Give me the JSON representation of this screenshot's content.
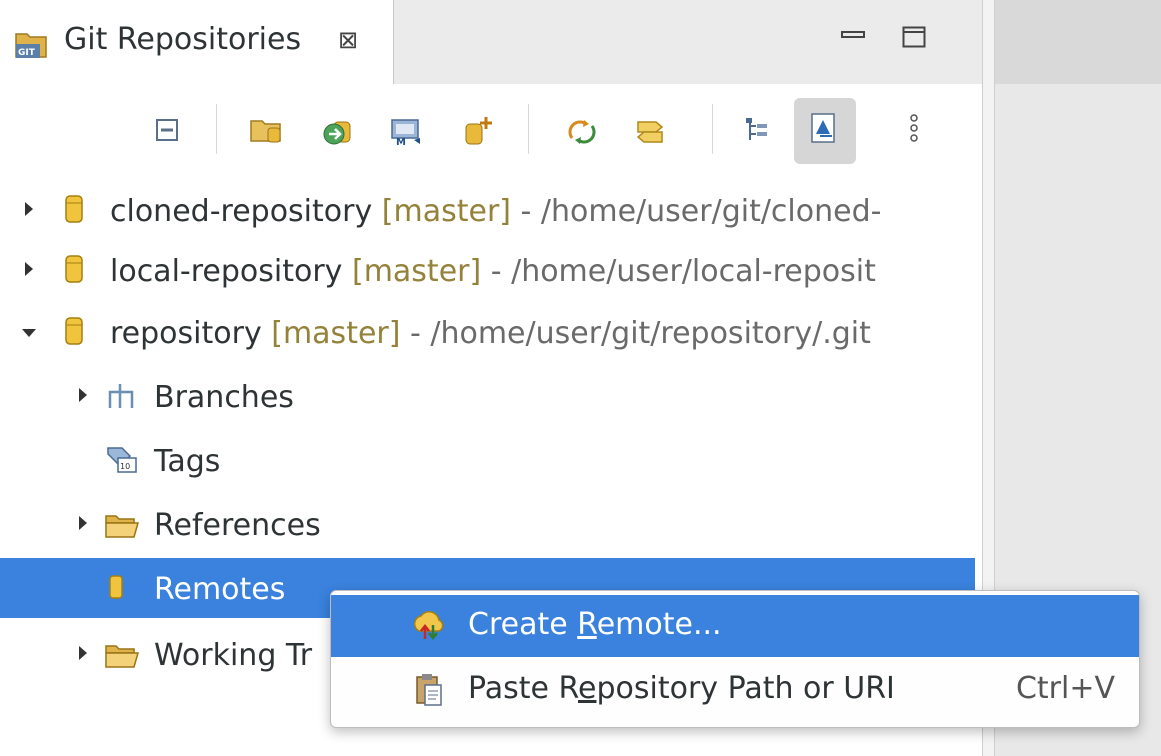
{
  "view": {
    "title": "Git Repositories",
    "close_glyph": "⊠",
    "icon": "git-repositories-view-icon"
  },
  "toolbar": {
    "buttons": [
      {
        "name": "collapse-all-button",
        "icon": "collapse-all-icon"
      },
      {
        "name": "add-existing-repository-button",
        "icon": "add-repository-icon"
      },
      {
        "name": "clone-repository-button",
        "icon": "clone-repository-icon"
      },
      {
        "name": "import-projects-button",
        "icon": "import-projects-icon"
      },
      {
        "name": "create-repository-button",
        "icon": "create-repository-icon"
      },
      {
        "name": "refresh-button",
        "icon": "refresh-icon"
      },
      {
        "name": "link-with-selection-button",
        "icon": "link-with-selection-icon"
      },
      {
        "name": "hierarchical-branch-layout-button",
        "icon": "hierarchy-icon"
      },
      {
        "name": "compact-view-button",
        "icon": "compact-view-icon",
        "pressed": true
      },
      {
        "name": "view-menu-button",
        "icon": "vertical-dots-icon"
      }
    ]
  },
  "tree": {
    "repositories": [
      {
        "name": "cloned-repository",
        "branch": "[master]",
        "path": " - /home/user/git/cloned-",
        "expanded": false
      },
      {
        "name": "local-repository",
        "branch": "[master]",
        "path": " - /home/user/local-reposit",
        "expanded": false
      },
      {
        "name": "repository",
        "branch": "[master]",
        "path": " - /home/user/git/repository/.git",
        "expanded": true
      }
    ],
    "children": [
      {
        "label": "Branches",
        "icon": "branches-icon",
        "expandable": true
      },
      {
        "label": "Tags",
        "icon": "tags-icon",
        "expandable": false
      },
      {
        "label": "References",
        "icon": "folder-icon",
        "expandable": true
      },
      {
        "label": "Remotes",
        "icon": "remote-icon",
        "expandable": false,
        "selected": true
      },
      {
        "label": "Working Tr",
        "icon": "folder-icon",
        "expandable": true
      }
    ]
  },
  "context_menu": {
    "items": [
      {
        "pre": "Create ",
        "mnemonic": "R",
        "post": "emote...",
        "shortcut": "",
        "icon": "create-remote-icon",
        "highlighted": true
      },
      {
        "pre": "Paste R",
        "mnemonic": "e",
        "post": "pository Path or URI",
        "shortcut": "Ctrl+V",
        "icon": "paste-icon",
        "highlighted": false
      }
    ]
  },
  "colors": {
    "selection": "#3a82dd",
    "branch_label": "#94823a",
    "path_text": "#6a6a6a"
  }
}
